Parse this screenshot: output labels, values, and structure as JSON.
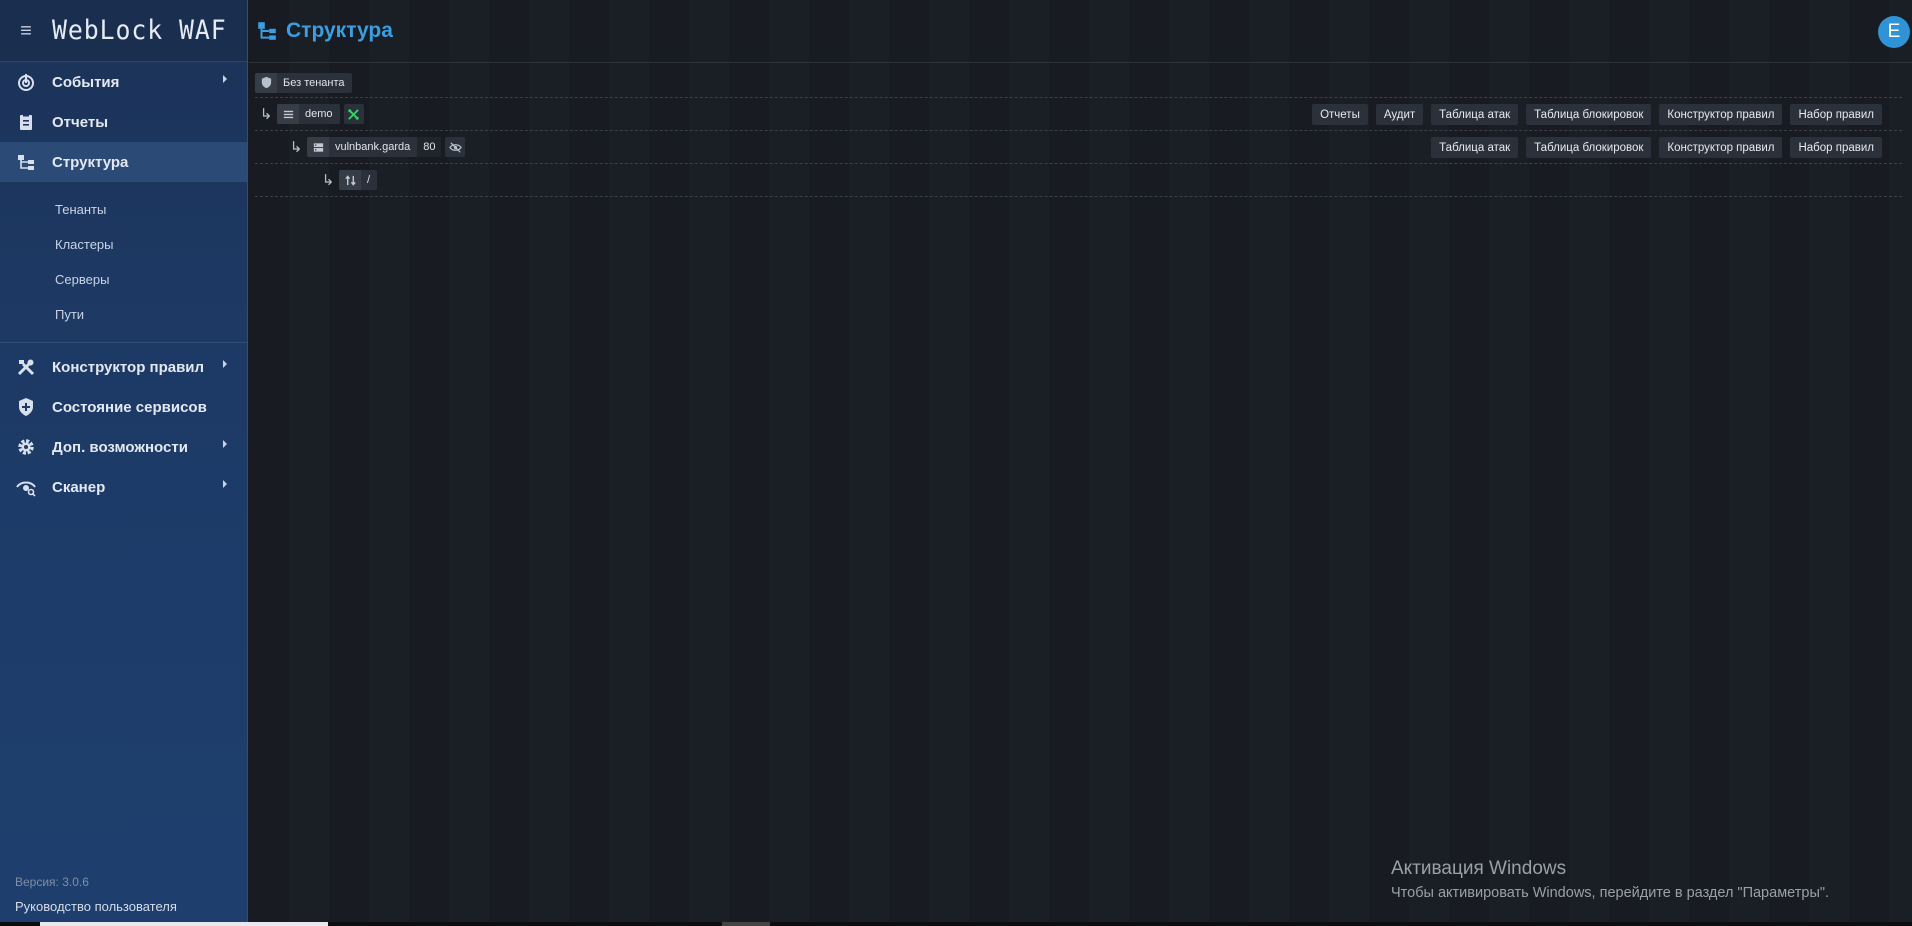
{
  "app": {
    "brand": "WebLock WAF"
  },
  "sidebar": {
    "items": [
      {
        "label": "События",
        "icon": "radar-icon"
      },
      {
        "label": "Отчеты",
        "icon": "clipboard-icon"
      },
      {
        "label": "Структура",
        "icon": "structure-icon"
      }
    ],
    "sub_items": [
      "Тенанты",
      "Кластеры",
      "Серверы",
      "Пути"
    ],
    "items_after": [
      {
        "label": "Конструктор правил",
        "icon": "tools-icon"
      },
      {
        "label": "Состояние сервисов",
        "icon": "shield-plus-icon"
      },
      {
        "label": "Доп. возможности",
        "icon": "gear-icon"
      },
      {
        "label": "Сканер",
        "icon": "scanner-eye-icon"
      }
    ],
    "version": "Версия: 3.0.6",
    "manual": "Руководство пользователя"
  },
  "header": {
    "title": "Структура",
    "avatar_letter": "E"
  },
  "tree": {
    "tenant": {
      "label": "Без тенанта"
    },
    "cluster": {
      "name": "demo",
      "actions": [
        "Отчеты",
        "Аудит",
        "Таблица атак",
        "Таблица блокировок",
        "Конструктор правил",
        "Набор правил"
      ]
    },
    "server": {
      "name": "vulnbank.garda",
      "port": "80",
      "actions": [
        "Таблица атак",
        "Таблица блокировок",
        "Конструктор правил",
        "Набор правил"
      ]
    },
    "path": {
      "name": "/"
    }
  },
  "watermark": {
    "title": "Активация Windows",
    "subtitle": "Чтобы активировать Windows, перейдите в раздел \"Параметры\"."
  },
  "colors": {
    "accent": "#3b9ee0",
    "sidebar_bg": "#1d3a66",
    "main_bg": "#181c22",
    "active_item": "#2b4a76"
  }
}
